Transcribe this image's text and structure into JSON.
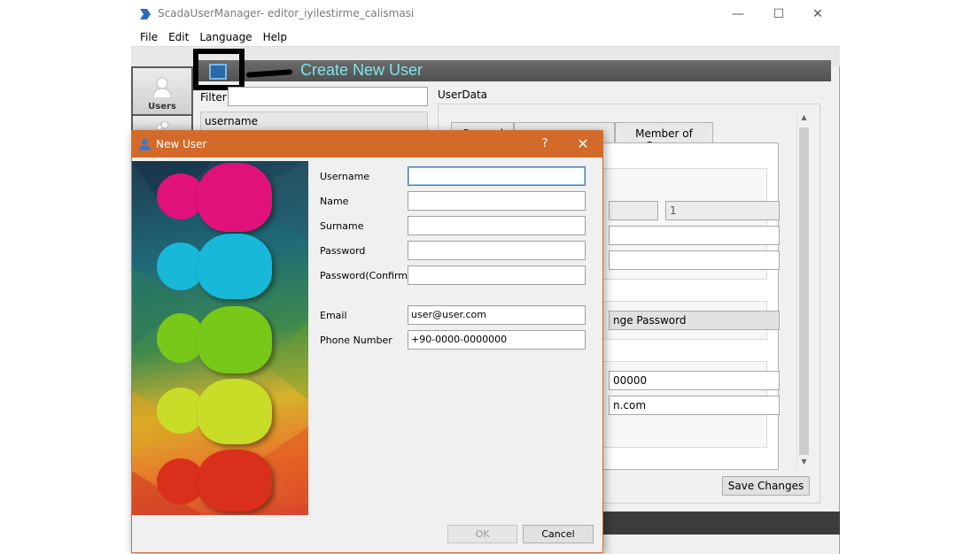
{
  "app": {
    "title": "ScadaUserManager- editor_iyilestirme_calismasi",
    "controls": {
      "minimize": "—",
      "maximize": "☐",
      "close": "✕"
    }
  },
  "menu": [
    "File",
    "Edit",
    "Language",
    "Help"
  ],
  "nav": {
    "users_label": "Users"
  },
  "header": {
    "title": "Create New User"
  },
  "left_panel": {
    "filter_label": "Filter",
    "filter_value": "",
    "list_header": "username"
  },
  "right_panel": {
    "title": "UserData",
    "tabs": [
      "General",
      "",
      "Member of Groups"
    ],
    "fields": {
      "field_a": "",
      "field_b": "1",
      "change_password_label": "nge Password",
      "phone_partial": "00000",
      "email_partial": "n.com"
    },
    "save_label": "Save Changes"
  },
  "dialog": {
    "title": "New User",
    "help": "?",
    "close": "✕",
    "labels": {
      "username": "Username",
      "name": "Name",
      "surname": "Surname",
      "password": "Password",
      "password_confirm": "Password(Confirm)",
      "email": "Email",
      "phone": "Phone Number"
    },
    "values": {
      "username": "",
      "name": "",
      "surname": "",
      "password": "",
      "password_confirm": "",
      "email": "user@user.com",
      "phone": "+90-0000-0000000"
    },
    "ok_label": "OK",
    "cancel_label": "Cancel"
  },
  "colors": {
    "dialog_titlebar": "#d46a2a",
    "header_title": "#7fe3e8",
    "person_colors": [
      "#e0127a",
      "#18b8d8",
      "#78c81a",
      "#c8dc28",
      "#d8301a"
    ]
  }
}
